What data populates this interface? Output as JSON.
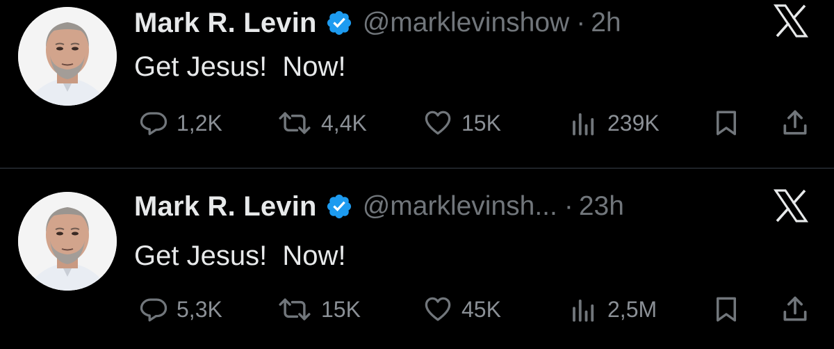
{
  "colors": {
    "background": "#000000",
    "text_primary": "#e7e9ea",
    "text_secondary": "#71767b",
    "verified_blue": "#1d9bf0",
    "divider": "#1f2328"
  },
  "icons": [
    "reply-icon",
    "retweet-icon",
    "like-icon",
    "views-icon",
    "bookmark-icon",
    "share-icon",
    "x-logo-icon",
    "verified-badge-icon"
  ],
  "tweets": [
    {
      "author_name": "Mark R. Levin",
      "handle": "@marklevinshow",
      "separator": "·",
      "time": "2h",
      "text": "Get Jesus!  Now!",
      "replies": "1,2K",
      "retweets": "4,4K",
      "likes": "15K",
      "views": "239K"
    },
    {
      "author_name": "Mark R. Levin",
      "handle": "@marklevinsh...",
      "separator": "·",
      "time": "23h",
      "text": "Get Jesus!  Now!",
      "replies": "5,3K",
      "retweets": "15K",
      "likes": "45K",
      "views": "2,5M"
    }
  ]
}
